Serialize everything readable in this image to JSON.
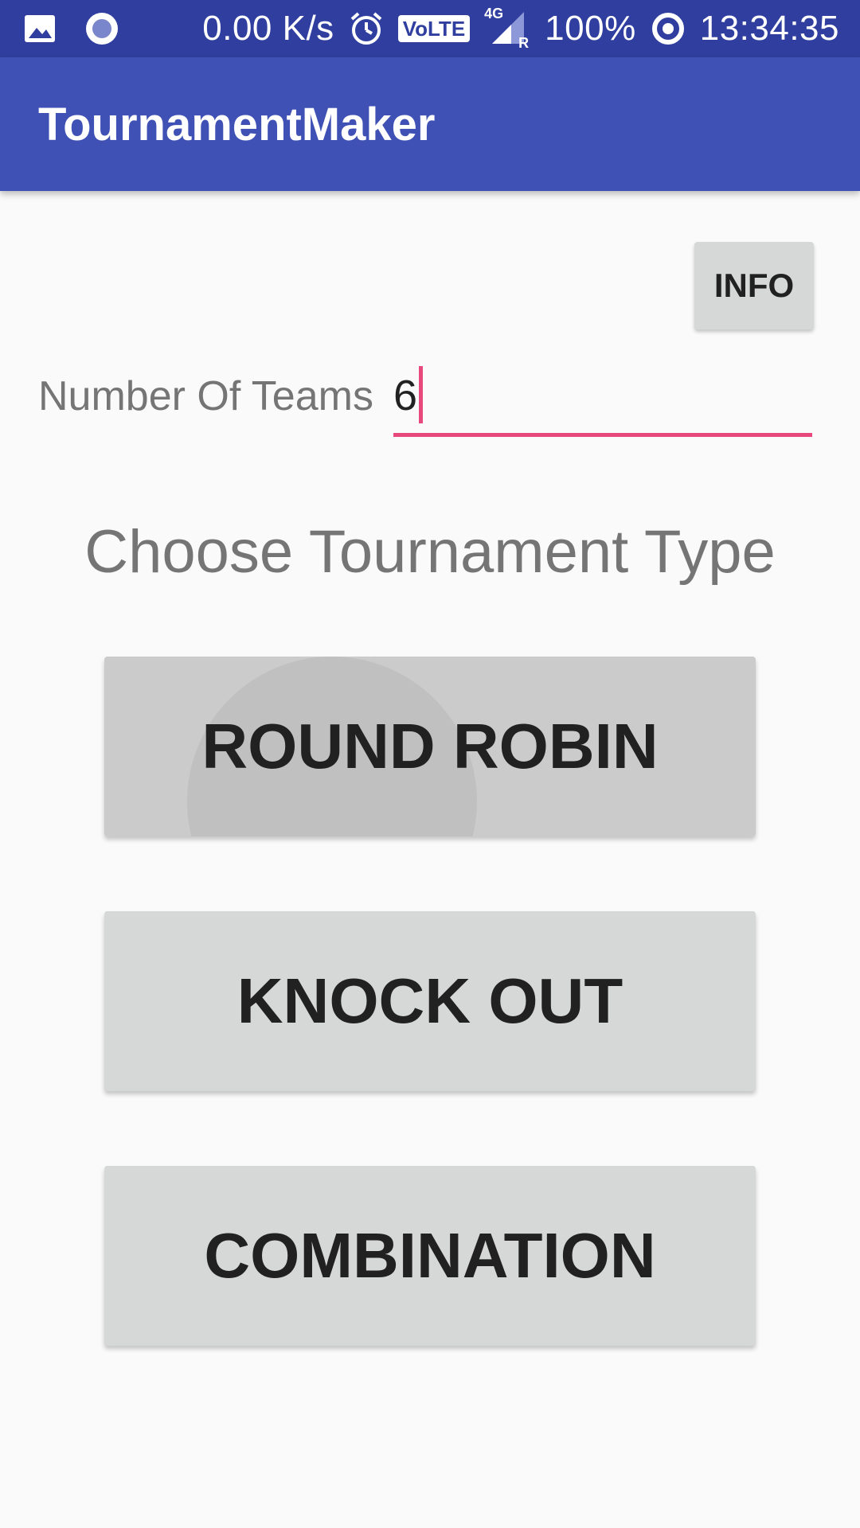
{
  "status_bar": {
    "net_speed": "0.00 K/s",
    "volte": "VoLTE",
    "network": "4G",
    "roaming": "R",
    "battery": "100%",
    "time": "13:34:35",
    "icons": [
      "gallery-icon",
      "record-icon",
      "alarm-icon",
      "signal-icon",
      "battery-ring-icon"
    ]
  },
  "app_bar": {
    "title": "TournamentMaker"
  },
  "info_button": {
    "label": "INFO"
  },
  "teams": {
    "label": "Number Of Teams",
    "value": "6"
  },
  "section": {
    "title": "Choose Tournament Type"
  },
  "buttons": {
    "round_robin": "ROUND ROBIN",
    "knock_out": "KNOCK OUT",
    "combination": "COMBINATION"
  },
  "colors": {
    "status_bar": "#303f9f",
    "app_bar": "#3f51b5",
    "accent": "#e8487c",
    "button": "#d6d7d7",
    "background": "#fafafa"
  }
}
